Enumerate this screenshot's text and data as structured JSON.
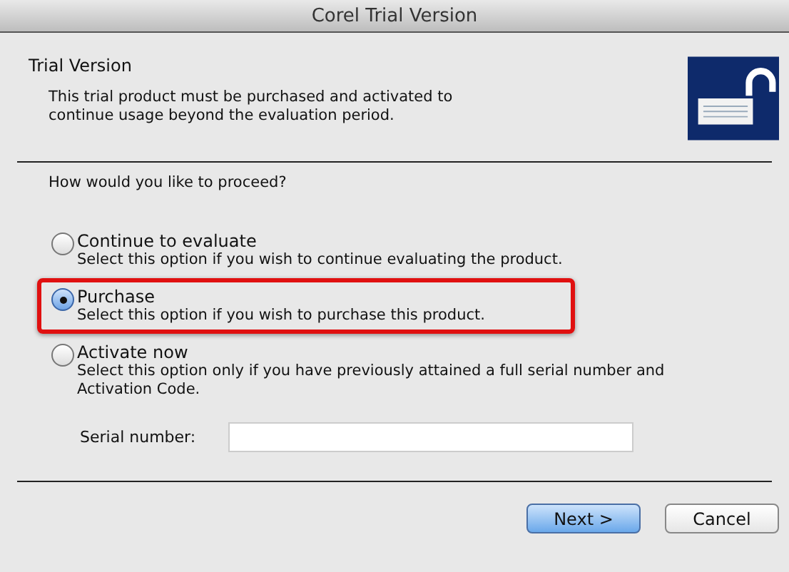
{
  "window": {
    "title": "Corel Trial Version"
  },
  "header": {
    "title": "Trial Version",
    "description": "This trial product must be purchased and activated to continue usage beyond the evaluation period."
  },
  "question": "How would you like to proceed?",
  "options": [
    {
      "label": "Continue to evaluate",
      "description": "Select this option if you wish to continue evaluating the product.",
      "selected": false,
      "highlighted": false
    },
    {
      "label": "Purchase",
      "description": "Select this option if you wish to purchase this product.",
      "selected": true,
      "highlighted": true
    },
    {
      "label": "Activate now",
      "description": "Select this option only if you have previously attained a full serial number and Activation Code.",
      "selected": false,
      "highlighted": false
    }
  ],
  "serial": {
    "label": "Serial number:"
  },
  "buttons": [
    {
      "label": "Next >",
      "default": true
    },
    {
      "label": "Cancel",
      "default": false
    }
  ]
}
